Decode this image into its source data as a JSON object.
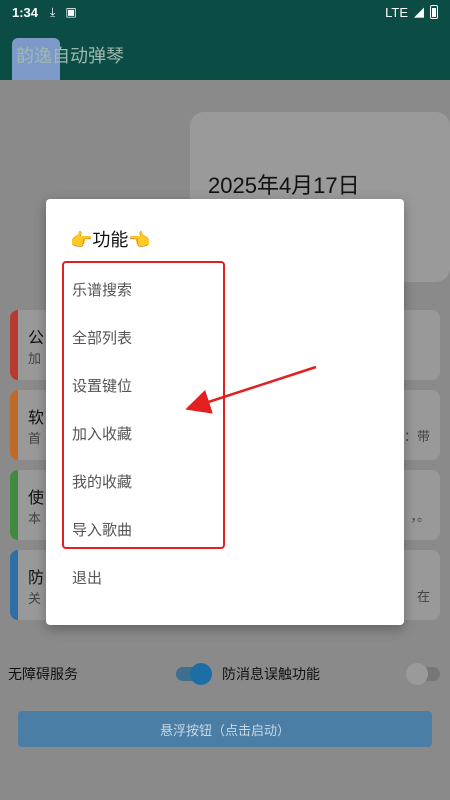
{
  "status_bar": {
    "time": "1:34",
    "network": "LTE",
    "icons": [
      "download-icon",
      "a-icon",
      "signal-icon",
      "battery-icon"
    ]
  },
  "app_bar": {
    "title": "韵逸自动弹琴"
  },
  "background": {
    "date": "2025年4月17日",
    "cards": [
      {
        "title": "公",
        "subtitle": "加",
        "right": "",
        "color": "#b83a2f"
      },
      {
        "title": "软",
        "subtitle": "首",
        "right": "：带",
        "color": "#c06a2a"
      },
      {
        "title": "使",
        "subtitle": "本",
        "right": "，。",
        "color": "#3f8a3f"
      },
      {
        "title": "防",
        "subtitle": "关",
        "right": "在",
        "color": "#2f6fa8"
      }
    ],
    "accessibility_label": "无障碍服务",
    "anti_touch_label": "防消息误触功能",
    "float_button": "悬浮按钮（点击启动）"
  },
  "dialog": {
    "title": "👉功能👈",
    "items": [
      "乐谱搜索",
      "全部列表",
      "设置键位",
      "加入收藏",
      "我的收藏",
      "导入歌曲",
      "退出"
    ]
  },
  "annotation": {
    "box_color": "#e41f1f",
    "arrow_color": "#e41f1f"
  }
}
